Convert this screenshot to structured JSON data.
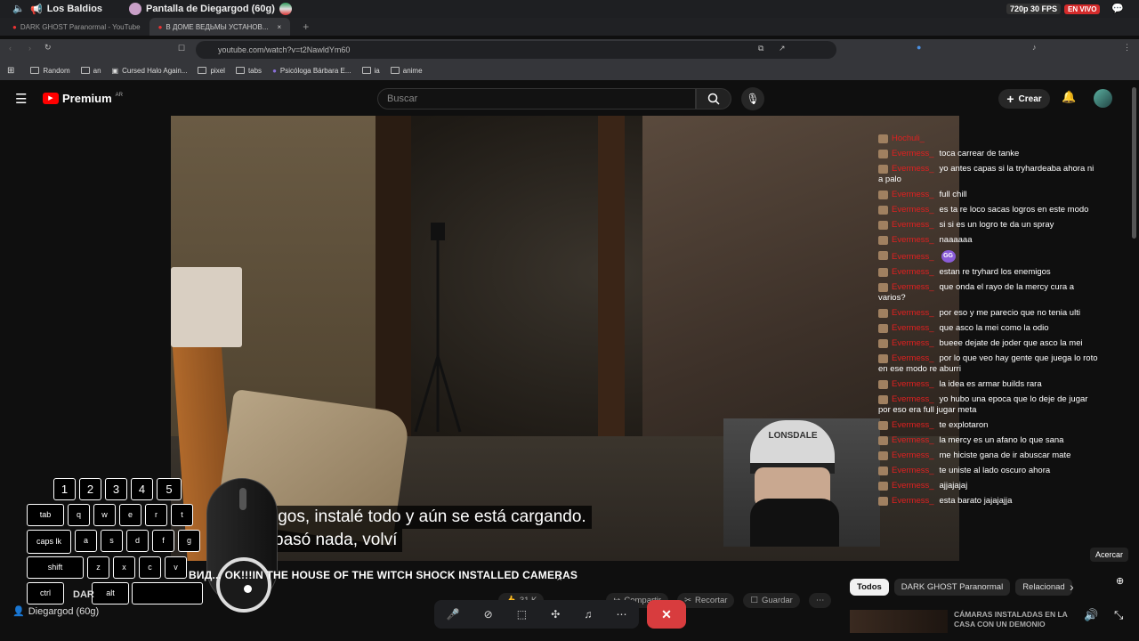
{
  "discord_bar": {
    "channel": "Los Baldios",
    "stream_title": "Pantalla de Diegargod (60g)",
    "quality": "720p 30 FPS",
    "live": "EN VIVO"
  },
  "browser": {
    "tabs": [
      {
        "label": "DARK GHOST Paranormal - YouTube",
        "active": false
      },
      {
        "label": "В ДОМЕ ВЕДЬМЫ УСТАНОВ...",
        "active": true
      }
    ],
    "url": "youtube.com/watch?v=t2NawldYm60",
    "bookmarks": [
      "Random",
      "an",
      "Cursed Halo Again...",
      "pixel",
      "tabs",
      "Psicóloga Bárbara E...",
      "ia",
      "anime"
    ]
  },
  "youtube": {
    "logo": "Premium",
    "logo_sup": "AR",
    "search_placeholder": "Buscar",
    "create_label": "Crear"
  },
  "video": {
    "subtitle_line1": "igos, instalé todo y aún se está cargando.",
    "subtitle_line2": "pasó nada, volví",
    "cap_logo": "LONSDALE",
    "title": "ВИД... OK!!!IN THE HOUSE OF THE WITCH SHOCK INSTALLED CAMERAS"
  },
  "chat": {
    "messages": [
      {
        "user": "Hochuli_",
        "text": ""
      },
      {
        "user": "Evermess_",
        "text": "toca carrear de tanke"
      },
      {
        "user": "Evermess_",
        "text": "yo antes capas si la tryhardeaba ahora ni a palo"
      },
      {
        "user": "Evermess_",
        "text": "full chill"
      },
      {
        "user": "Evermess_",
        "text": "es ta re loco sacas logros en este modo"
      },
      {
        "user": "Evermess_",
        "text": "si si es un logro te da un spray"
      },
      {
        "user": "Evermess_",
        "text": "naaaaaa"
      },
      {
        "user": "Evermess_",
        "text": "",
        "emote": "GG"
      },
      {
        "user": "Evermess_",
        "text": "estan re tryhard los enemigos"
      },
      {
        "user": "Evermess_",
        "text": "que onda el rayo de la mercy cura a varios?"
      },
      {
        "user": "Evermess_",
        "text": "por eso y me parecio que no tenia ulti"
      },
      {
        "user": "Evermess_",
        "text": "que asco la mei como la odio"
      },
      {
        "user": "Evermess_",
        "text": "bueee dejate de joder que asco la mei"
      },
      {
        "user": "Evermess_",
        "text": "por lo que veo hay gente que juega lo roto en ese modo re aburri"
      },
      {
        "user": "Evermess_",
        "text": "la idea es armar builds rara"
      },
      {
        "user": "Evermess_",
        "text": "yo hubo una epoca que lo deje de jugar por eso era full jugar meta"
      },
      {
        "user": "Evermess_",
        "text": "te explotaron"
      },
      {
        "user": "Evermess_",
        "text": "la mercy es un afano lo que sana"
      },
      {
        "user": "Evermess_",
        "text": "me hiciste gana de ir abuscar mate"
      },
      {
        "user": "Evermess_",
        "text": "te uniste al lado oscuro ahora"
      },
      {
        "user": "Evermess_",
        "text": "ajjajajaj"
      },
      {
        "user": "Evermess_",
        "text": "esta barato jajajajja"
      }
    ]
  },
  "keyboard": {
    "row_numbers": [
      "1",
      "2",
      "3",
      "4",
      "5"
    ],
    "tab": "tab",
    "q": "q",
    "w": "w",
    "e": "e",
    "r": "r",
    "t": "t",
    "caps": "caps lk",
    "a": "a",
    "s": "s",
    "d": "d",
    "f": "f",
    "g": "g",
    "shift": "shift",
    "z": "z",
    "x": "x",
    "c": "c",
    "v": "v",
    "ctrl": "ctrl",
    "alt": "alt"
  },
  "below_video": {
    "channel_partial": "DAR",
    "likes": "31 K",
    "share": "Compartir",
    "clip": "Recortar",
    "save": "Guardar",
    "chips": [
      "Todos",
      "DARK GHOST Paranormal",
      "Relacionad"
    ],
    "related_title": "CÁMARAS INSTALADAS EN LA CASA CON UN DEMONIO"
  },
  "tooltip": "Acercar",
  "stream_user": "Diegargod (60g)",
  "colors": {
    "chat_user": "#e02020",
    "live": "#d42b2b",
    "end_call": "#d83c3e"
  }
}
